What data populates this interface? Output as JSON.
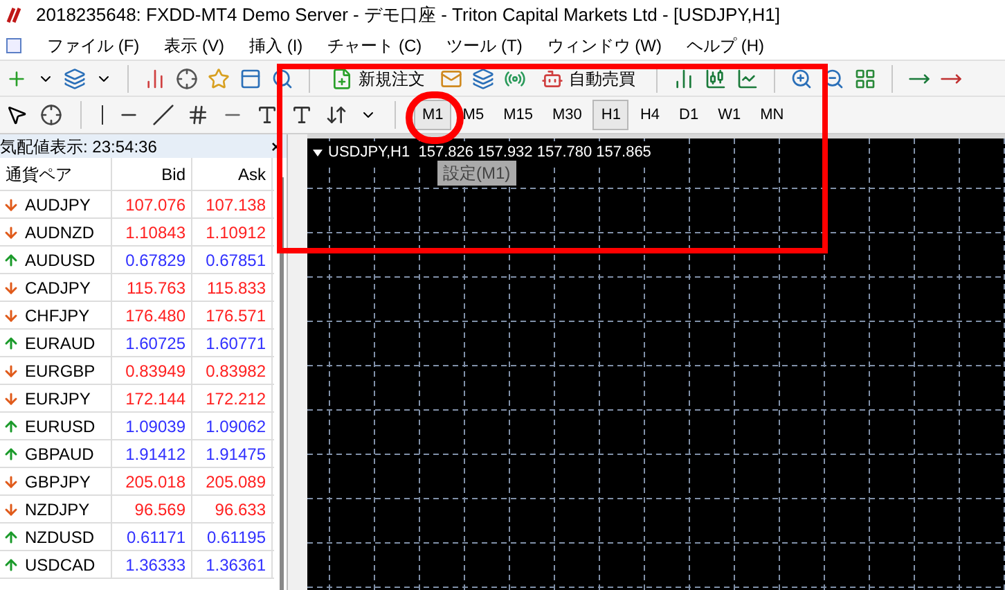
{
  "window": {
    "title": "2018235648: FXDD-MT4 Demo Server - デモ口座 - Triton Capital Markets Ltd - [USDJPY,H1]"
  },
  "menu": [
    "ファイル (F)",
    "表示 (V)",
    "挿入 (I)",
    "チャート (C)",
    "ツール (T)",
    "ウィンドウ (W)",
    "ヘルプ (H)"
  ],
  "toolbar": {
    "new_order": "新規注文",
    "auto_trading": "自動売買"
  },
  "timeframes": [
    {
      "label": "M1",
      "selected": true
    },
    {
      "label": "M5",
      "selected": false
    },
    {
      "label": "M15",
      "selected": false
    },
    {
      "label": "M30",
      "selected": false
    },
    {
      "label": "H1",
      "selected": true
    },
    {
      "label": "H4",
      "selected": false
    },
    {
      "label": "D1",
      "selected": false
    },
    {
      "label": "W1",
      "selected": false
    },
    {
      "label": "MN",
      "selected": false
    }
  ],
  "market_watch": {
    "title": "気配値表示: 23:54:36",
    "close": "×",
    "columns": [
      "通貨ペア",
      "Bid",
      "Ask"
    ],
    "rows": [
      {
        "symbol": "AUDJPY",
        "bid": "107.076",
        "ask": "107.138",
        "kind": "down"
      },
      {
        "symbol": "AUDNZD",
        "bid": "1.10843",
        "ask": "1.10912",
        "kind": "down"
      },
      {
        "symbol": "AUDUSD",
        "bid": "0.67829",
        "ask": "0.67851",
        "kind": "up"
      },
      {
        "symbol": "CADJPY",
        "bid": "115.763",
        "ask": "115.833",
        "kind": "down"
      },
      {
        "symbol": "CHFJPY",
        "bid": "176.480",
        "ask": "176.571",
        "kind": "down"
      },
      {
        "symbol": "EURAUD",
        "bid": "1.60725",
        "ask": "1.60771",
        "kind": "up"
      },
      {
        "symbol": "EURGBP",
        "bid": "0.83949",
        "ask": "0.83982",
        "kind": "down"
      },
      {
        "symbol": "EURJPY",
        "bid": "172.144",
        "ask": "172.212",
        "kind": "down"
      },
      {
        "symbol": "EURUSD",
        "bid": "1.09039",
        "ask": "1.09062",
        "kind": "up"
      },
      {
        "symbol": "GBPAUD",
        "bid": "1.91412",
        "ask": "1.91475",
        "kind": "up"
      },
      {
        "symbol": "GBPJPY",
        "bid": "205.018",
        "ask": "205.089",
        "kind": "down"
      },
      {
        "symbol": "NZDJPY",
        "bid": "96.569",
        "ask": "96.633",
        "kind": "down"
      },
      {
        "symbol": "NZDUSD",
        "bid": "0.61171",
        "ask": "0.61195",
        "kind": "up"
      },
      {
        "symbol": "USDCAD",
        "bid": "1.36333",
        "ask": "1.36361",
        "kind": "up"
      }
    ]
  },
  "chart": {
    "header": "USDJPY,H1  157.826 157.932 157.780 157.865",
    "tooltip": "設定(M1)"
  }
}
